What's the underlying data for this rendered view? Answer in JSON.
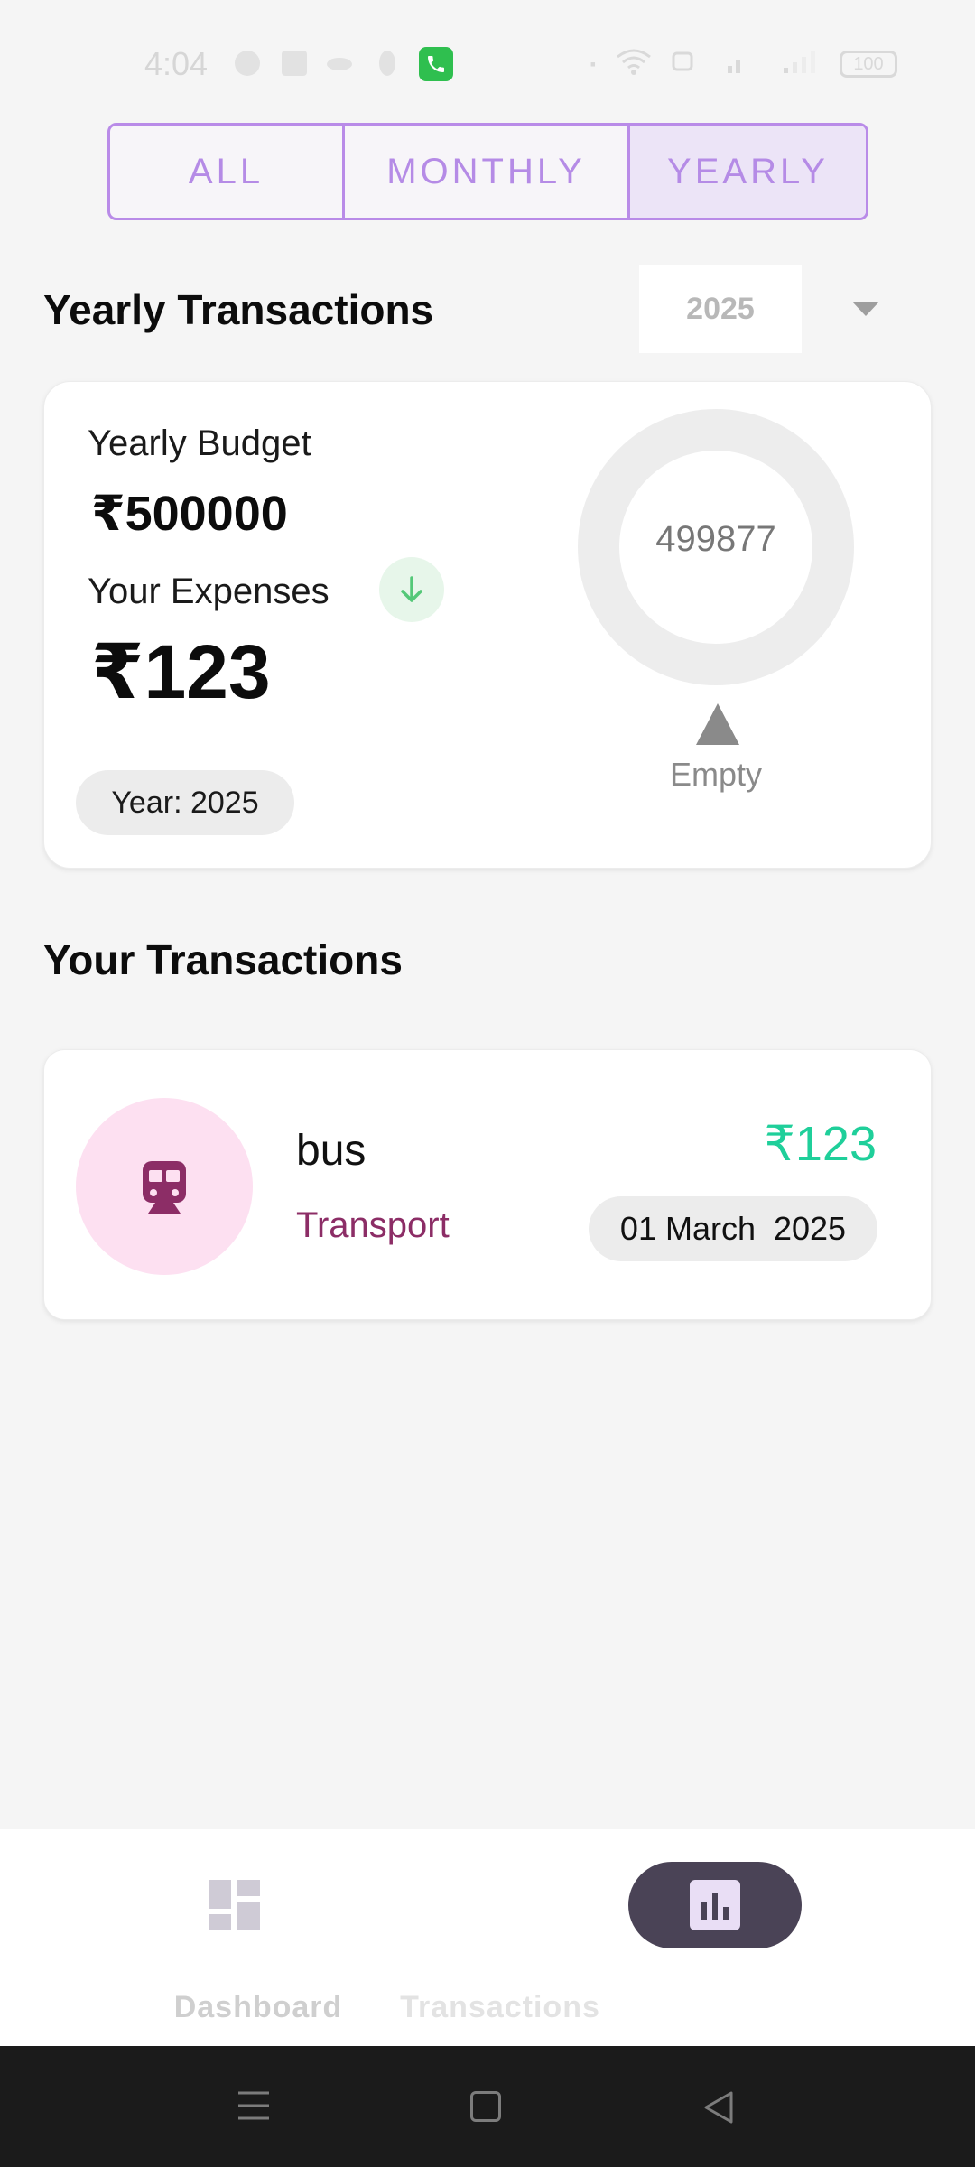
{
  "status_bar": {
    "time": "4:04",
    "battery": "100"
  },
  "filter_tabs": [
    {
      "label": "ALL",
      "selected": false
    },
    {
      "label": "MONTHLY",
      "selected": false
    },
    {
      "label": "YEARLY",
      "selected": true
    }
  ],
  "header": {
    "title": "Yearly Transactions",
    "year_value": "2025"
  },
  "budget_card": {
    "budget_label": "Yearly Budget",
    "budget_amount": "₹500000",
    "expenses_label": "Your Expenses",
    "expenses_amount": "₹123",
    "year_chip": "Year: 2025",
    "remaining_value": "499877",
    "empty_label": "Empty"
  },
  "transactions": {
    "title": "Your Transactions",
    "items": [
      {
        "name": "bus",
        "category": "Transport",
        "amount": "₹123",
        "date": "01 March  2025",
        "icon": "train-icon"
      }
    ]
  },
  "bottom_nav": {
    "items": [
      {
        "label": "Dashboard",
        "icon": "dashboard-icon",
        "active": false
      },
      {
        "label": "Transactions",
        "icon": "bar-chart-icon",
        "active": true
      }
    ]
  },
  "colors": {
    "accent": "#b58be6",
    "income_green": "#1fcf9a",
    "category_magenta": "#8c2d66",
    "nav_active": "#4a4356"
  }
}
